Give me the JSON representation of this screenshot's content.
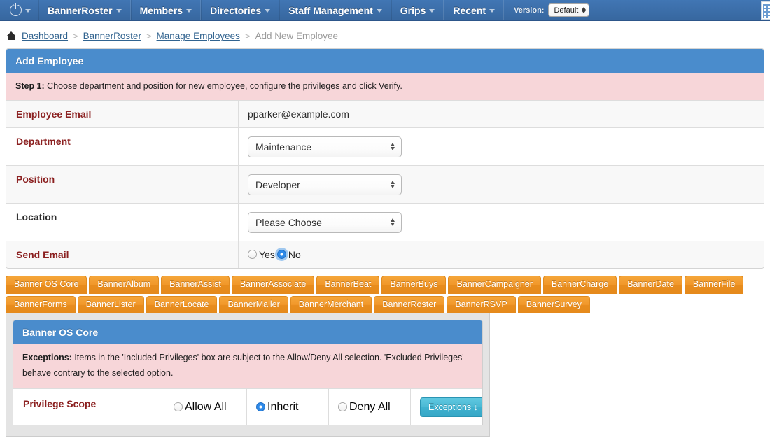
{
  "navbar": {
    "power_icon": "power-icon",
    "items": [
      {
        "label": "BannerRoster",
        "caret": true
      },
      {
        "label": "Members",
        "caret": true
      },
      {
        "label": "Directories",
        "caret": true
      },
      {
        "label": "Staff Management",
        "caret": true
      },
      {
        "label": "Grips",
        "caret": true
      },
      {
        "label": "Recent",
        "caret": true
      }
    ],
    "version_label": "Version:",
    "version_value": "Default",
    "right_icon": "building-icon",
    "background_color": "#37679f"
  },
  "breadcrumb": {
    "home_icon": "home-icon",
    "items": [
      {
        "label": "Dashboard",
        "link": true
      },
      {
        "label": "BannerRoster",
        "link": true
      },
      {
        "label": "Manage Employees",
        "link": true
      },
      {
        "label": "Add New Employee",
        "link": false
      }
    ],
    "separator": ">"
  },
  "panel": {
    "title": "Add Employee",
    "header_color": "#4a8ccc",
    "alert_prefix": "Step 1:",
    "alert_text": " Choose department and position for new employee, configure the privileges and click Verify.",
    "alert_color": "#f7d6d9",
    "rows": [
      {
        "label": "Employee Email",
        "label_style": "red",
        "type": "text",
        "value": "pparker@example.com"
      },
      {
        "label": "Department",
        "label_style": "red",
        "type": "select",
        "value": "Maintenance"
      },
      {
        "label": "Position",
        "label_style": "red",
        "type": "select",
        "value": "Developer"
      },
      {
        "label": "Location",
        "label_style": "dark",
        "type": "select",
        "value": "Please Choose"
      },
      {
        "label": "Send Email",
        "label_style": "red",
        "type": "radio",
        "options": [
          {
            "label": "Yes",
            "checked": false,
            "focused": false
          },
          {
            "label": "No",
            "checked": true,
            "focused": true
          }
        ]
      }
    ]
  },
  "tabs": {
    "active": "Banner OS Core",
    "color": "#ee9322",
    "items": [
      "Banner OS Core",
      "BannerAlbum",
      "BannerAssist",
      "BannerAssociate",
      "BannerBeat",
      "BannerBuys",
      "BannerCampaigner",
      "BannerCharge",
      "BannerDate",
      "BannerFile",
      "BannerForms",
      "BannerLister",
      "BannerLocate",
      "BannerMailer",
      "BannerMerchant",
      "BannerRoster",
      "BannerRSVP",
      "BannerSurvey"
    ]
  },
  "subpanel": {
    "title": "Banner OS Core",
    "alert_prefix": "Exceptions:",
    "alert_text": " Items in the 'Included Privileges' box are subject to the Allow/Deny All selection. 'Excluded Privileges' behave contrary to the selected option.",
    "scope_label": "Privilege Scope",
    "scope_options": [
      {
        "label": "Allow All",
        "checked": false
      },
      {
        "label": "Inherit",
        "checked": true
      },
      {
        "label": "Deny All",
        "checked": false
      }
    ],
    "exceptions_button": "Exceptions ↓",
    "exceptions_button_color": "#3fb1cf"
  }
}
